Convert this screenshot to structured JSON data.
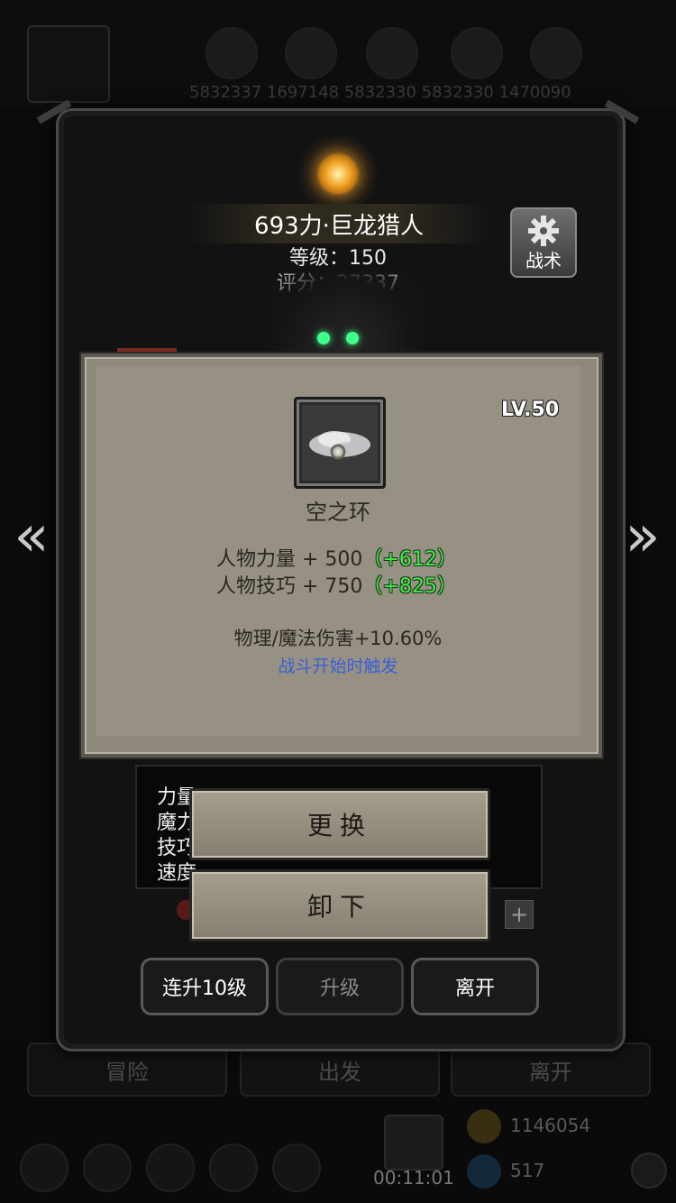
{
  "background": {
    "resource_strip": "5832337 1697148 5832330 5832330 1470090",
    "bottom_nav": [
      "冒险",
      "出发",
      "离开"
    ],
    "gold": "1146054",
    "gems": "517",
    "timer": "00:11:01"
  },
  "character": {
    "name": "693力·巨龙猎人",
    "level_text": "等级：150",
    "score_text": "评分：27337",
    "tactic_label": "战术"
  },
  "item": {
    "level": "LV.50",
    "name": "空之环",
    "attributes": [
      {
        "label": "人物力量 + 500",
        "bonus": "（+612）"
      },
      {
        "label": "人物技巧 + 750",
        "bonus": "（+825）"
      }
    ],
    "effect": "物理/魔法伤害+10.60%",
    "trigger": "战斗开始时触发"
  },
  "stats_behind": [
    "力量",
    "魔力",
    "技巧",
    "速度"
  ],
  "actions": {
    "replace": "更换",
    "unequip": "卸下"
  },
  "bottom_buttons": {
    "upgrade10": "连升10级",
    "upgrade": "升级",
    "leave": "离开"
  },
  "colors": {
    "bonus_green": "#45e84a",
    "trigger_blue": "#3a5fd8",
    "parchment": "#979184"
  }
}
